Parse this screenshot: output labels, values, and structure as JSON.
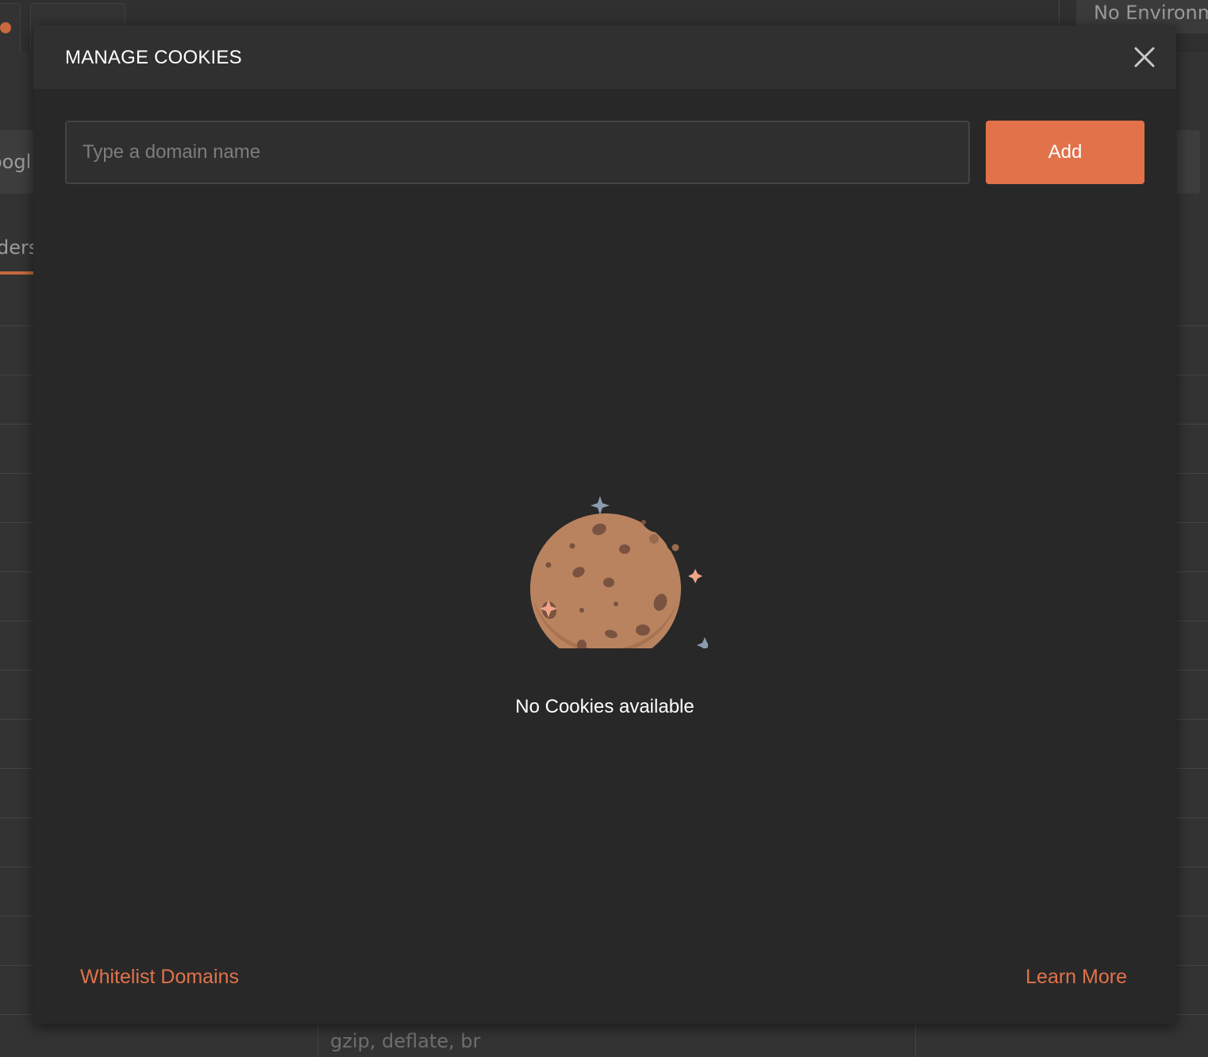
{
  "background": {
    "environment_label": "No Environment",
    "url_fragment": "oogl",
    "headers_tab_fragment": "ders",
    "accept_encoding_value": "gzip, deflate, br"
  },
  "modal": {
    "title": "MANAGE COOKIES",
    "close_icon": "close-icon",
    "domain_input": {
      "placeholder": "Type a domain name",
      "value": ""
    },
    "add_label": "Add",
    "empty_state": {
      "icon": "cookie-icon",
      "message": "No Cookies available"
    },
    "footer": {
      "whitelist_label": "Whitelist Domains",
      "learn_more_label": "Learn More"
    }
  },
  "colors": {
    "accent": "#e2724a",
    "modal_bg": "#282828",
    "header_bg": "#303030",
    "cookie": "#b98360"
  }
}
